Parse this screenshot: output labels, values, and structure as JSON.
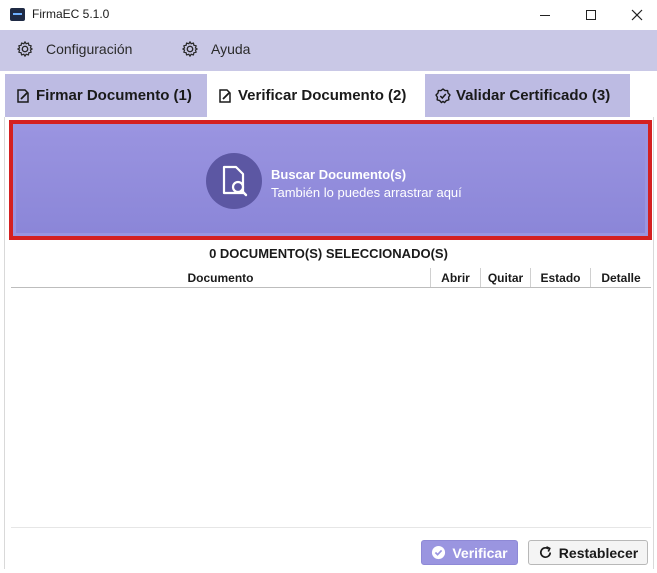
{
  "window": {
    "title": "FirmaEC 5.1.0",
    "controls": [
      "minimize",
      "maximize",
      "close"
    ]
  },
  "menu": {
    "items": [
      {
        "label": "Configuración",
        "icon": "gear-icon"
      },
      {
        "label": "Ayuda",
        "icon": "help-icon"
      }
    ]
  },
  "tabs": [
    {
      "label": "Firmar Documento (1)",
      "icon": "edit-document-icon",
      "selected": false
    },
    {
      "label": "Verificar Documento (2)",
      "icon": "edit-document-icon",
      "selected": true
    },
    {
      "label": "Validar Certificado (3)",
      "icon": "verified-badge-icon",
      "selected": false
    }
  ],
  "dropzone": {
    "title": "Buscar Documento(s)",
    "subtitle": "También lo puedes arrastrar aquí",
    "icon": "search-document-icon"
  },
  "selection": {
    "count_label": "0 DOCUMENTO(S) SELECCIONADO(S)"
  },
  "table": {
    "columns": [
      "Documento",
      "Abrir",
      "Quitar",
      "Estado",
      "Detalle"
    ],
    "rows": []
  },
  "actions": {
    "verificar_label": "Verificar",
    "restablecer_label": "Restablecer"
  },
  "colors": {
    "menu_bg": "#c9c8e6",
    "tab_bg": "#bdbbe3",
    "accent": "#9a95df",
    "highlight_border": "#d42020"
  }
}
